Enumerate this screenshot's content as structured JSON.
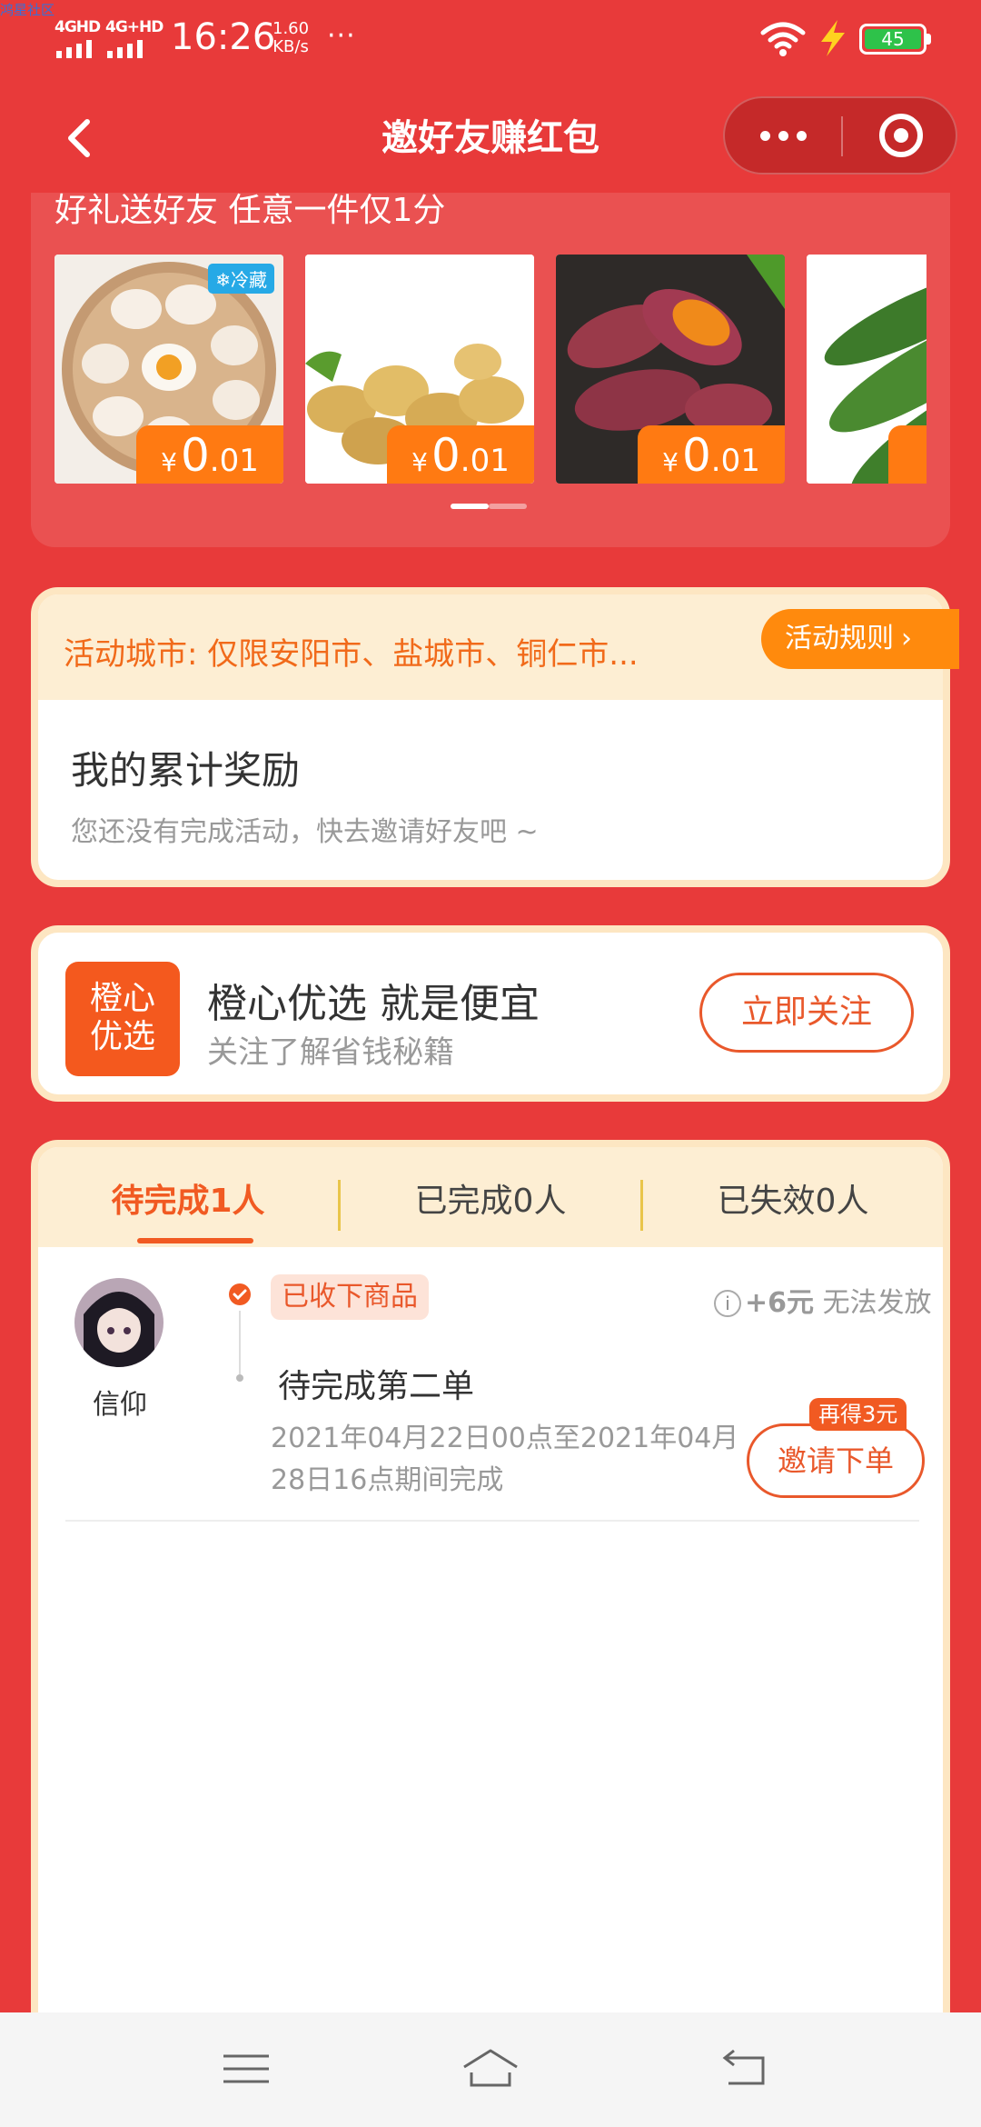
{
  "watermark": "鸿星社区",
  "status_bar": {
    "signal1_label": "4GHD",
    "signal2_label": "4G+HD",
    "time": "16:26",
    "speed_value": "1.60",
    "speed_unit": "KB/s",
    "more": "···",
    "battery": "45"
  },
  "nav": {
    "title": "邀好友赚红包"
  },
  "promo": {
    "title": "好礼送好友 任意一件仅1分",
    "products": [
      {
        "name": "eggs",
        "currency": "¥",
        "price_int": "0",
        "price_dec": ".01",
        "tag": "冷藏"
      },
      {
        "name": "potatoes",
        "currency": "¥",
        "price_int": "0",
        "price_dec": ".01"
      },
      {
        "name": "sweet-potatoes",
        "currency": "¥",
        "price_int": "0",
        "price_dec": ".01"
      },
      {
        "name": "cucumbers",
        "currency": "¥"
      }
    ]
  },
  "reward_card": {
    "city_text": "活动城市: 仅限安阳市、盐城市、铜仁市...",
    "rules_label": "活动规则",
    "rules_chevron": "›",
    "title": "我的累计奖励",
    "subtitle": "您还没有完成活动，快去邀请好友吧 ~"
  },
  "follow_card": {
    "logo_line1": "橙心",
    "logo_line2": "优选",
    "title": "橙心优选 就是便宜",
    "subtitle": "关注了解省钱秘籍",
    "button": "立即关注"
  },
  "list_card": {
    "tabs": [
      {
        "label": "待完成1人",
        "active": true
      },
      {
        "label": "已完成0人",
        "active": false
      },
      {
        "label": "已失效0人",
        "active": false
      }
    ],
    "rows": [
      {
        "username": "信仰",
        "status": "已收下商品",
        "info_icon": "i",
        "bonus": "+6元",
        "bonus_note": "无法发放",
        "order_title": "待完成第二单",
        "order_time": "2021年04月22日00点至2021年04月28日16点期间完成",
        "button": "邀请下单",
        "extra_badge": "再得3元"
      }
    ]
  },
  "colors": {
    "background": "#E83A3A",
    "accent_orange": "#FF7A12",
    "accent_red_orange": "#F15A22",
    "card_border": "#FDE6C2",
    "battery_green": "#2EC24A"
  },
  "icons": [
    "back-arrow-icon",
    "more-dots-icon",
    "target-icon",
    "wifi-icon",
    "charging-icon",
    "battery-icon",
    "info-icon",
    "menu-icon",
    "home-icon",
    "back-icon"
  ]
}
